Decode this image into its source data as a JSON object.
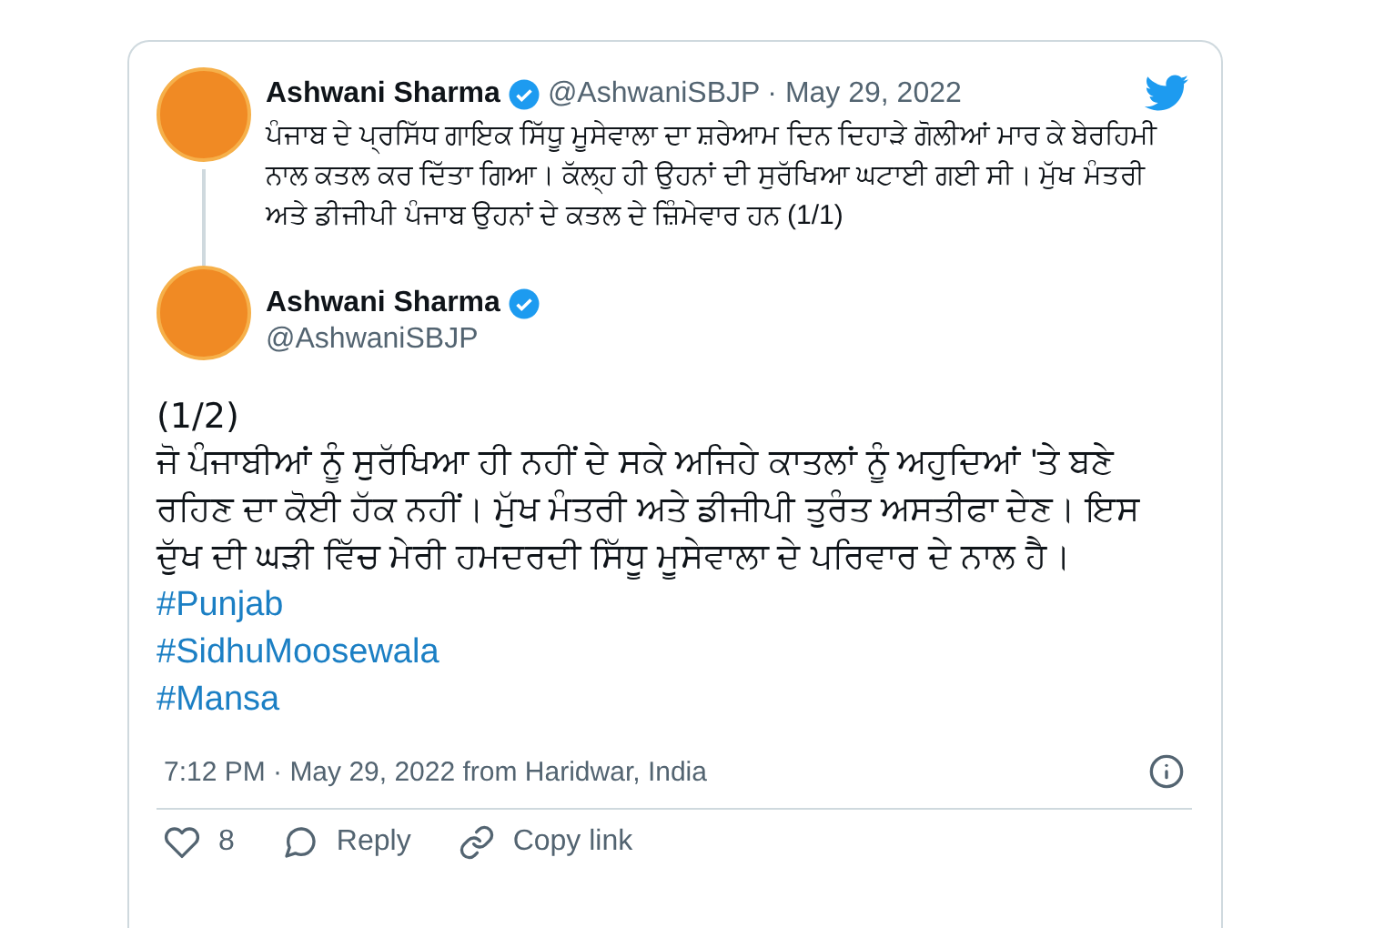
{
  "quoted_tweet": {
    "name": "Ashwani Sharma",
    "verified": true,
    "handle": "@AshwaniSBJP",
    "date": "· May 29, 2022",
    "text": "ਪੰਜਾਬ ਦੇ ਪ੍ਰਸਿੱਧ ਗਾਇਕ ਸਿੱਧੂ ਮੂਸੇਵਾਲਾ ਦਾ ਸ਼ਰੇਆਮ ਦਿਨ ਦਿਹਾੜੇ ਗੋਲੀਆਂ ਮਾਰ ਕੇ ਬੇਰਹਿਮੀ ਨਾਲ ਕਤਲ ਕਰ ਦਿੱਤਾ ਗਿਆ। ਕੱਲ੍ਹ ਹੀ ਉਹਨਾਂ ਦੀ ਸੁਰੱਖਿਆ ਘਟਾਈ ਗਈ ਸੀ। ਮੁੱਖ ਮੰਤਰੀ ਅਤੇ ਡੀਜੀਪੀ ਪੰਜਾਬ ਉਹਨਾਂ ਦੇ ਕਤਲ ਦੇ ਜ਼ਿੰਮੇਵਾਰ ਹਨ (1/1)"
  },
  "tweet": {
    "name": "Ashwani Sharma",
    "verified": true,
    "handle": "@AshwaniSBJP",
    "counter": "(1/2)",
    "text": "ਜੋ ਪੰਜਾਬੀਆਂ ਨੂੰ ਸੁਰੱਖਿਆ ਹੀ ਨਹੀਂ ਦੇ ਸਕੇ ਅਜਿਹੇ ਕਾਤਲਾਂ ਨੂੰ ਅਹੁਦਿਆਂ 'ਤੇ ਬਣੇ ਰਹਿਣ ਦਾ ਕੋਈ ਹੱਕ ਨਹੀਂ। ਮੁੱਖ ਮੰਤਰੀ ਅਤੇ ਡੀਜੀਪੀ ਤੁਰੰਤ ਅਸਤੀਫਾ ਦੇਣ। ਇਸ ਦੁੱਖ ਦੀ ਘੜੀ ਵਿੱਚ ਮੇਰੀ ਹਮਦਰਦੀ ਸਿੱਧੂ ਮੂਸੇਵਾਲਾ ਦੇ ਪਰਿਵਾਰ ਦੇ ਨਾਲ ਹੈ।",
    "hashtags": [
      "#Punjab",
      "#SidhuMoosewala",
      "#Mansa"
    ],
    "timestamp": "7:12 PM · May 29, 2022 from Haridwar, India"
  },
  "actions": [
    {
      "kind": "like",
      "label": "8"
    },
    {
      "kind": "reply",
      "label": "Reply"
    },
    {
      "kind": "copy",
      "label": "Copy link"
    }
  ]
}
